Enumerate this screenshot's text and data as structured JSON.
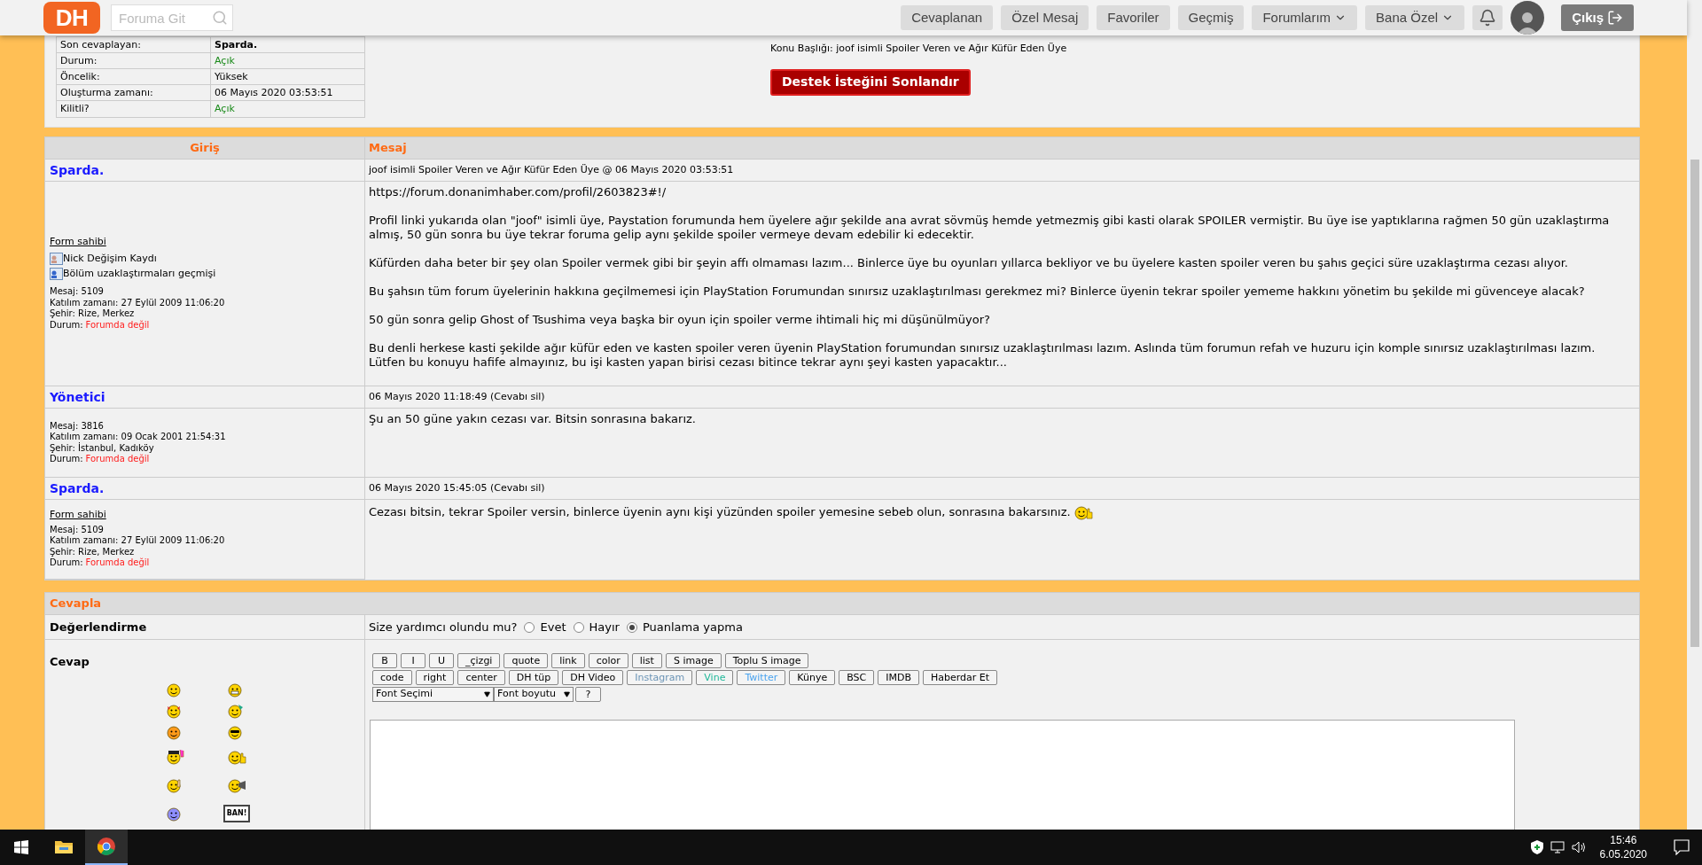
{
  "header": {
    "logo": "DH",
    "search": {
      "placeholder": "Foruma Git"
    },
    "nav": [
      {
        "label": "Cevaplanan",
        "dropdown": false
      },
      {
        "label": "Özel Mesaj",
        "dropdown": false
      },
      {
        "label": "Favoriler",
        "dropdown": false
      },
      {
        "label": "Geçmiş",
        "dropdown": false
      },
      {
        "label": "Forumlarım",
        "dropdown": true
      },
      {
        "label": "Bana Özel",
        "dropdown": true
      }
    ],
    "logout": "Çıkış"
  },
  "ticket": {
    "fields": [
      {
        "label": "Son cevaplayan:",
        "value": "Sparda.",
        "kind": "plain",
        "bold": true
      },
      {
        "label": "Durum:",
        "value": "Açık",
        "kind": "open",
        "bold": false
      },
      {
        "label": "Öncelik:",
        "value": "Yüksek",
        "kind": "plain",
        "bold": false
      },
      {
        "label": "Oluşturma zamanı:",
        "value": "06 Mayıs 2020 03:53:51",
        "kind": "plain",
        "bold": false
      },
      {
        "label": "Kilitli?",
        "value": "Açık",
        "kind": "open",
        "bold": false
      }
    ],
    "subject": "Konu Başlığı: joof isimli Spoiler Veren ve Ağır Küfür Eden Üye",
    "close_button": "Destek İsteğini Sonlandır"
  },
  "posts_table": {
    "columns": [
      "Giriş",
      "Mesaj"
    ],
    "posts": [
      {
        "author": "Sparda.",
        "meta": "joof isimli Spoiler Veren ve Ağır Küfür Eden Üye @ 06 Mayıs 2020 03:53:51",
        "owner": "Form sahibi",
        "links": [
          "Nick Değişim Kaydı",
          "Bölüm uzaklaştırmaları geçmişi"
        ],
        "stats": [
          "Mesaj: 5109",
          "Katılım zamanı: 27 Eylül 2009 11:06:20",
          "Şehir: Rize, Merkez"
        ],
        "status_label": "Durum:",
        "status": "Forumda değil",
        "paragraphs": [
          "https://forum.donanimhaber.com/profil/2603823#!/",
          "Profil linki yukarıda olan \"joof\" isimli üye, Paystation forumunda hem üyelere ağır şekilde ana avrat sövmüş hemde yetmezmiş gibi kasti olarak SPOILER vermiştir. Bu üye ise yaptıklarına rağmen 50 gün uzaklaştırma almış, 50 gün sonra bu üye tekrar foruma gelip aynı şekilde spoiler vermeye devam edebilir ki edecektir.",
          "Küfürden daha beter bir şey olan Spoiler vermek gibi bir şeyin affı olmaması lazım... Binlerce üye bu oyunları yıllarca bekliyor ve bu üyelere kasten spoiler veren bu şahıs geçici süre uzaklaştırma cezası alıyor.",
          "Bu şahsın tüm forum üyelerinin hakkına geçilmemesi için PlayStation Forumundan sınırsız uzaklaştırılması gerekmez mi? Binlerce üyenin tekrar spoiler yememe hakkını yönetim bu şekilde mi güvenceye alacak?",
          "50 gün sonra gelip Ghost of Tsushima veya başka bir oyun için spoiler verme ihtimali hiç mi düşünülmüyor?",
          "Bu denli herkese kasti şekilde ağır küfür eden ve kasten spoiler veren üyenin PlayStation forumundan sınırsız uzaklaştırılması lazım. Aslında tüm forumun refah ve huzuru için komple sınırsız uzaklaştırılması lazım.\nLütfen bu konuyu hafife almayınız, bu işi kasten yapan birisi cezası bitince tekrar aynı şeyi kasten yapacaktır..."
        ],
        "emoticon": false
      },
      {
        "author": "Yönetici",
        "meta": "06 Mayıs 2020 11:18:49 (Cevabı sil)",
        "stats": [
          "Mesaj: 3816",
          "Katılım zamanı: 09 Ocak 2001 21:54:31",
          "Şehir: İstanbul, Kadıköy"
        ],
        "status_label": "Durum:",
        "status": "Forumda değil",
        "paragraphs": [
          "Şu an 50 güne yakın cezası var. Bitsin sonrasına bakarız."
        ],
        "emoticon": false
      },
      {
        "author": "Sparda.",
        "meta": "06 Mayıs 2020 15:45:05 (Cevabı sil)",
        "owner": "Form sahibi",
        "stats": [
          "Mesaj: 5109",
          "Katılım zamanı: 27 Eylül 2009 11:06:20",
          "Şehir: Rize, Merkez"
        ],
        "status_label": "Durum:",
        "status": "Forumda değil",
        "paragraphs": [
          "Cezası bitsin, tekrar Spoiler versin, binlerce üyenin aynı kişi yüzünden spoiler yemesine sebeb olun, sonrasına bakarsınız."
        ],
        "emoticon": true
      }
    ]
  },
  "reply": {
    "title": "Cevapla",
    "rating_label": "Değerlendirme",
    "rating_question": "Size yardımcı olundu mu?",
    "rating_options": [
      {
        "label": "Evet",
        "selected": false
      },
      {
        "label": "Hayır",
        "selected": false
      },
      {
        "label": "Puanlama yapma",
        "selected": true
      }
    ],
    "answer_label": "Cevap",
    "smileys": [
      {
        "kind": "smile"
      },
      {
        "kind": "grin"
      },
      {
        "kind": "devil"
      },
      {
        "kind": "crazy"
      },
      {
        "kind": "orange"
      },
      {
        "kind": "cool"
      },
      {
        "kind": "rock"
      },
      {
        "kind": "thumbs"
      },
      {
        "kind": "thinking"
      },
      {
        "kind": "megaphone"
      },
      {
        "kind": "blue"
      },
      {
        "kind": "sign",
        "text": "BAN!"
      }
    ],
    "toolbar_rows": [
      [
        {
          "label": "B"
        },
        {
          "label": "I"
        },
        {
          "label": "U"
        },
        {
          "label": "_çizgi"
        },
        {
          "label": "quote"
        },
        {
          "label": "link"
        },
        {
          "label": "color"
        },
        {
          "label": "list"
        },
        {
          "label": "S image"
        },
        {
          "label": "Toplu S image"
        }
      ],
      [
        {
          "label": "code"
        },
        {
          "label": "right"
        },
        {
          "label": "center"
        },
        {
          "label": "DH tüp"
        },
        {
          "label": "DH Video"
        },
        {
          "label": "Instagram",
          "color": "#6a93b5"
        },
        {
          "label": "Vine",
          "color": "#21b89a"
        },
        {
          "label": "Twitter",
          "color": "#4aa3ee"
        },
        {
          "label": "Künye"
        },
        {
          "label": "BSC"
        },
        {
          "label": "IMDB"
        },
        {
          "label": "Haberdar Et"
        }
      ]
    ],
    "font_select": "Font Seçimi",
    "size_select": "Font boyutu",
    "help_button": "?"
  },
  "taskbar": {
    "apps": [
      {
        "kind": "explorer",
        "selected": false
      },
      {
        "kind": "chrome",
        "selected": true
      }
    ],
    "time": "15:46",
    "date": "6.05.2020"
  }
}
